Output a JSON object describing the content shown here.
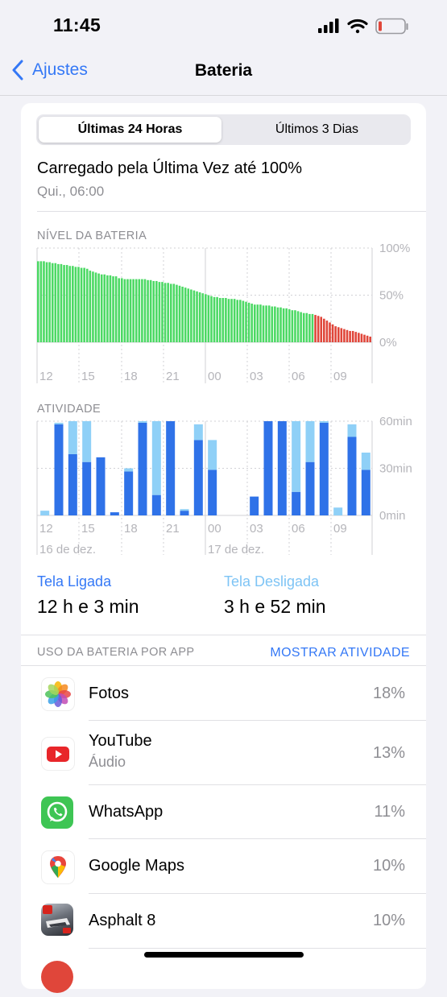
{
  "status_bar": {
    "time": "11:45"
  },
  "nav": {
    "back_label": "Ajustes",
    "title": "Bateria"
  },
  "segments": [
    "Últimas 24 Horas",
    "Últimos 3 Dias"
  ],
  "last_charge": {
    "title": "Carregado pela Última Vez até 100%",
    "subtitle": "Qui., 06:00"
  },
  "colors": {
    "accent": "#3478f6",
    "green": "#4cd964",
    "red": "#e0463a",
    "blue": "#2f72e8",
    "light_blue": "#8fd0f7",
    "grid": "#d1d1d6",
    "muted": "#8e8e93"
  },
  "battery_chart": {
    "label": "NÍVEL DA BATERIA",
    "y_ticks": [
      "100%",
      "50%",
      "0%"
    ],
    "x_ticks": [
      "12",
      "15",
      "18",
      "21",
      "00",
      "03",
      "06",
      "09"
    ],
    "low_from_index": 96
  },
  "activity_chart": {
    "label": "ATIVIDADE",
    "y_ticks": [
      "60min",
      "30min",
      "0min"
    ],
    "x_ticks": [
      "12",
      "15",
      "18",
      "21",
      "00",
      "03",
      "06",
      "09"
    ],
    "date_labels": [
      "16 de dez.",
      "17 de dez."
    ]
  },
  "chart_data": [
    {
      "type": "bar",
      "title": "NÍVEL DA BATERIA",
      "y_unit": "%",
      "ylim": [
        0,
        100
      ],
      "x_ticks": [
        "12",
        "15",
        "18",
        "21",
        "00",
        "03",
        "06",
        "09"
      ],
      "values": [
        86,
        86,
        86,
        85,
        85,
        84,
        84,
        83,
        83,
        82,
        82,
        81,
        81,
        80,
        80,
        79,
        79,
        78,
        76,
        75,
        74,
        73,
        72,
        72,
        71,
        71,
        70,
        70,
        68,
        68,
        67,
        67,
        67,
        67,
        67,
        67,
        67,
        67,
        66,
        66,
        65,
        65,
        64,
        64,
        63,
        63,
        62,
        62,
        61,
        60,
        59,
        58,
        57,
        56,
        55,
        54,
        53,
        52,
        51,
        50,
        49,
        48,
        48,
        47,
        47,
        47,
        46,
        46,
        46,
        45,
        45,
        44,
        43,
        42,
        41,
        40,
        40,
        40,
        39,
        39,
        39,
        38,
        38,
        37,
        37,
        36,
        36,
        35,
        34,
        34,
        33,
        32,
        31,
        31,
        30,
        30,
        29,
        28,
        27,
        25,
        23,
        21,
        19,
        17,
        16,
        15,
        14,
        13,
        12,
        12,
        11,
        10,
        9,
        8,
        7,
        6
      ],
      "low_color_from_index": 96
    },
    {
      "type": "bar",
      "title": "ATIVIDADE",
      "y_unit": "min",
      "ylim": [
        0,
        60
      ],
      "x_ticks": [
        "12",
        "15",
        "18",
        "21",
        "00",
        "03",
        "06",
        "09"
      ],
      "series": [
        {
          "name": "Tela Ligada",
          "values": [
            0,
            58,
            39,
            34,
            37,
            2,
            28,
            59,
            13,
            60,
            3,
            48,
            29,
            0,
            0,
            12,
            60,
            60,
            15,
            34,
            59,
            0,
            50,
            29
          ]
        },
        {
          "name": "Tela Desligada",
          "values": [
            3,
            1,
            21,
            26,
            0,
            0,
            2,
            1,
            47,
            0,
            1,
            10,
            19,
            0,
            0,
            0,
            0,
            0,
            45,
            26,
            1,
            5,
            8,
            11
          ]
        }
      ]
    }
  ],
  "legend": {
    "on_label": "Tela Ligada",
    "on_value": "12 h e 3 min",
    "off_label": "Tela Desligada",
    "off_value": "3 h e 52 min"
  },
  "usage": {
    "header": "USO DA BATERIA POR APP",
    "action": "MOSTRAR ATIVIDADE",
    "apps": [
      {
        "name": "Fotos",
        "sub": "",
        "pct": "18%",
        "icon": "photos-icon"
      },
      {
        "name": "YouTube",
        "sub": "Áudio",
        "pct": "13%",
        "icon": "youtube-icon"
      },
      {
        "name": "WhatsApp",
        "sub": "",
        "pct": "11%",
        "icon": "whatsapp-icon"
      },
      {
        "name": "Google Maps",
        "sub": "",
        "pct": "10%",
        "icon": "google-maps-icon"
      },
      {
        "name": "Asphalt 8",
        "sub": "",
        "pct": "10%",
        "icon": "asphalt-icon"
      }
    ]
  }
}
